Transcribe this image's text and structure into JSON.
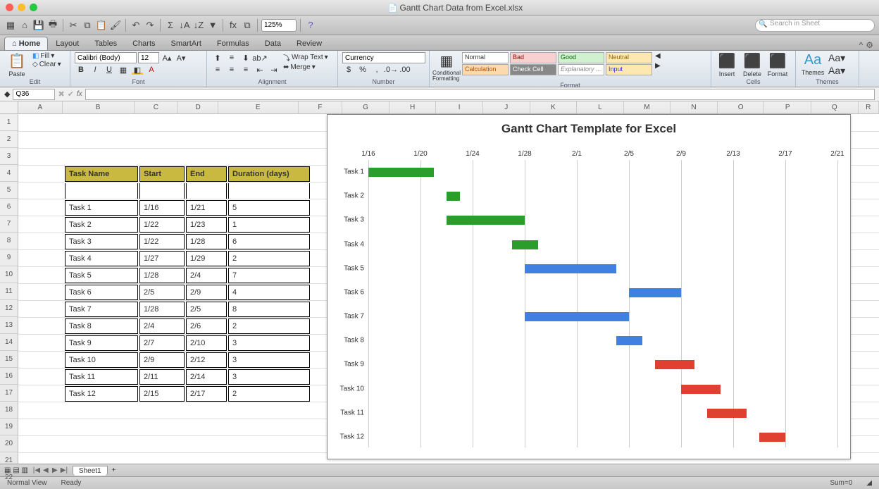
{
  "window": {
    "title": "Gantt Chart Data from Excel.xlsx"
  },
  "quickbar": {
    "zoom": "125%",
    "search_placeholder": "Search in Sheet"
  },
  "tabs": [
    "Home",
    "Layout",
    "Tables",
    "Charts",
    "SmartArt",
    "Formulas",
    "Data",
    "Review"
  ],
  "ribbon": {
    "groups": [
      "Edit",
      "Font",
      "Alignment",
      "Number",
      "Format",
      "Cells",
      "Themes"
    ],
    "paste": "Paste",
    "fill": "Fill",
    "clear": "Clear",
    "font_name": "Calibri (Body)",
    "font_size": "12",
    "wrap": "Wrap Text",
    "merge": "Merge",
    "number_format": "Currency",
    "cond": "Conditional Formatting",
    "styles": {
      "normal": "Normal",
      "bad": "Bad",
      "good": "Good",
      "neutral": "Neutral",
      "calculation": "Calculation",
      "check": "Check Cell",
      "explanatory": "Explanatory ...",
      "input": "Input"
    },
    "cells": {
      "insert": "Insert",
      "delete": "Delete",
      "format": "Format"
    },
    "themes": {
      "themes": "Themes",
      "aa": "Aa"
    }
  },
  "formula_bar": {
    "name_box": "Q36"
  },
  "columns": [
    "A",
    "B",
    "C",
    "D",
    "E",
    "F",
    "G",
    "H",
    "I",
    "J",
    "K",
    "L",
    "M",
    "N",
    "O",
    "P",
    "Q",
    "R"
  ],
  "row_count": 22,
  "table": {
    "headers": [
      "Task Name",
      "Start",
      "End",
      "Duration (days)"
    ],
    "rows": [
      [
        "Task 1",
        "1/16",
        "1/21",
        "5"
      ],
      [
        "Task 2",
        "1/22",
        "1/23",
        "1"
      ],
      [
        "Task 3",
        "1/22",
        "1/28",
        "6"
      ],
      [
        "Task 4",
        "1/27",
        "1/29",
        "2"
      ],
      [
        "Task 5",
        "1/28",
        "2/4",
        "7"
      ],
      [
        "Task 6",
        "2/5",
        "2/9",
        "4"
      ],
      [
        "Task 7",
        "1/28",
        "2/5",
        "8"
      ],
      [
        "Task 8",
        "2/4",
        "2/6",
        "2"
      ],
      [
        "Task 9",
        "2/7",
        "2/10",
        "3"
      ],
      [
        "Task 10",
        "2/9",
        "2/12",
        "3"
      ],
      [
        "Task 11",
        "2/11",
        "2/14",
        "3"
      ],
      [
        "Task 12",
        "2/15",
        "2/17",
        "2"
      ]
    ]
  },
  "chart_data": {
    "type": "bar",
    "title": "Gantt Chart Template for Excel",
    "x_ticks": [
      "1/16",
      "1/20",
      "1/24",
      "1/28",
      "2/1",
      "2/5",
      "2/9",
      "2/13",
      "2/17",
      "2/21"
    ],
    "x_range_days": [
      0,
      36
    ],
    "series": [
      {
        "name": "Task 1",
        "start_day": 0,
        "duration": 5,
        "color": "green"
      },
      {
        "name": "Task 2",
        "start_day": 6,
        "duration": 1,
        "color": "green"
      },
      {
        "name": "Task 3",
        "start_day": 6,
        "duration": 6,
        "color": "green"
      },
      {
        "name": "Task 4",
        "start_day": 11,
        "duration": 2,
        "color": "green"
      },
      {
        "name": "Task 5",
        "start_day": 12,
        "duration": 7,
        "color": "blue"
      },
      {
        "name": "Task 6",
        "start_day": 20,
        "duration": 4,
        "color": "blue"
      },
      {
        "name": "Task 7",
        "start_day": 12,
        "duration": 8,
        "color": "blue"
      },
      {
        "name": "Task 8",
        "start_day": 19,
        "duration": 2,
        "color": "blue"
      },
      {
        "name": "Task 9",
        "start_day": 22,
        "duration": 3,
        "color": "red"
      },
      {
        "name": "Task 10",
        "start_day": 24,
        "duration": 3,
        "color": "red"
      },
      {
        "name": "Task 11",
        "start_day": 26,
        "duration": 3,
        "color": "red"
      },
      {
        "name": "Task 12",
        "start_day": 30,
        "duration": 2,
        "color": "red"
      }
    ]
  },
  "sheet": {
    "name": "Sheet1"
  },
  "status": {
    "view": "Normal View",
    "ready": "Ready",
    "sum": "Sum=0"
  }
}
